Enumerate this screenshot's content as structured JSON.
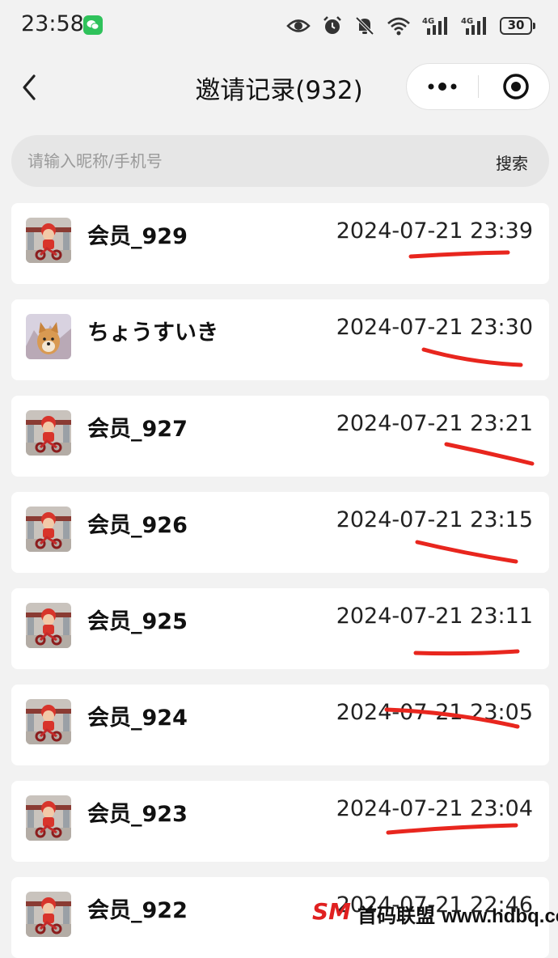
{
  "status_bar": {
    "time": "23:58",
    "battery": "30",
    "icons": [
      "wechat-icon",
      "eye-icon",
      "alarm-icon",
      "mute-bell-icon",
      "wifi-icon",
      "signal-4g-icon",
      "signal-4g-icon",
      "battery-icon"
    ],
    "network_label": "4G"
  },
  "nav": {
    "title": "邀请记录(932)",
    "icons": [
      "back-chevron-icon",
      "more-dots-icon",
      "close-target-icon"
    ]
  },
  "search": {
    "placeholder": "请输入昵称/手机号",
    "value": "",
    "button_label": "搜索"
  },
  "records": [
    {
      "name": "会员_929",
      "time": "2024-07-21 23:39",
      "avatar": "cartoon-scooter"
    },
    {
      "name": "ちょうすいき",
      "time": "2024-07-21 23:30",
      "avatar": "shiba-dog"
    },
    {
      "name": "会员_927",
      "time": "2024-07-21 23:21",
      "avatar": "cartoon-scooter"
    },
    {
      "name": "会员_926",
      "time": "2024-07-21 23:15",
      "avatar": "cartoon-scooter"
    },
    {
      "name": "会员_925",
      "time": "2024-07-21 23:11",
      "avatar": "cartoon-scooter"
    },
    {
      "name": "会员_924",
      "time": "2024-07-21 23:05",
      "avatar": "cartoon-scooter"
    },
    {
      "name": "会员_923",
      "time": "2024-07-21 23:04",
      "avatar": "cartoon-scooter"
    },
    {
      "name": "会员_922",
      "time": "2024-07-21 22:46",
      "avatar": "cartoon-scooter"
    }
  ],
  "watermark": {
    "logo": "SM",
    "text": "首码联盟",
    "url": "www.hdbq.cc"
  },
  "colors": {
    "background": "#f2f2f2",
    "card": "#ffffff",
    "marker": "#e8261e",
    "wechat": "#2fc25b"
  }
}
